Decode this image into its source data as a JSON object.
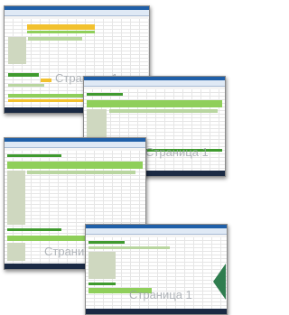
{
  "watermark_text": "Страница 1",
  "screens": [
    {
      "name": "excel-screenshot-1"
    },
    {
      "name": "excel-screenshot-2"
    },
    {
      "name": "excel-screenshot-3"
    },
    {
      "name": "excel-screenshot-4"
    }
  ]
}
